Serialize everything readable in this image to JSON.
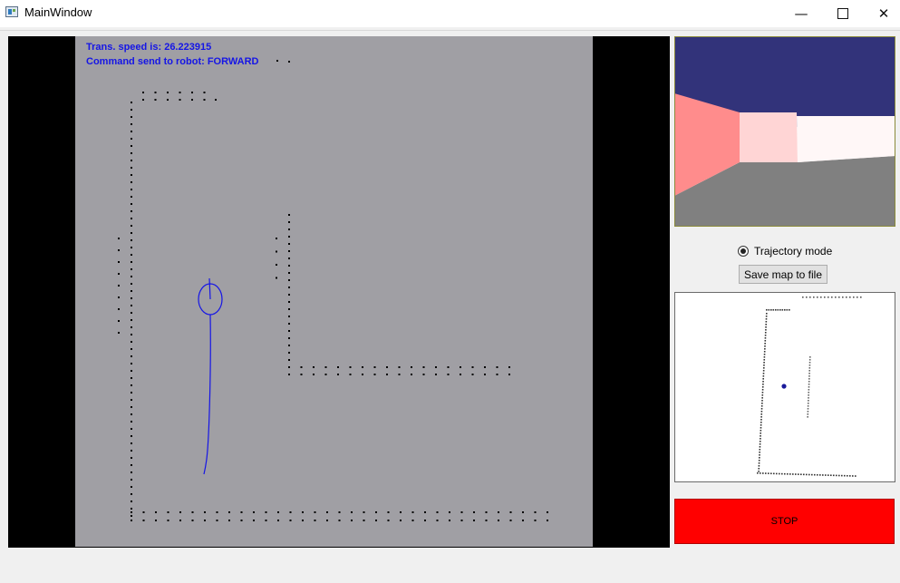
{
  "window": {
    "title": "MainWindow",
    "controls": [
      "minimize",
      "maximize",
      "close"
    ]
  },
  "map": {
    "speed_text": "Trans. speed is: 26.223915",
    "command_text": "Command send to robot: FORWARD",
    "background_color": "#a09fa4",
    "point_color": "#000000",
    "robot_color": "#1515e6"
  },
  "camera": {
    "colors": {
      "sky": "#32337a",
      "floor": "#808080",
      "wall_left": "#ff8c8c",
      "wall_front": "#ffd5d5",
      "wall_right": "#fff7f7"
    }
  },
  "controls": {
    "trajectory_label": "Trajectory mode",
    "trajectory_checked": true,
    "save_label": "Save map to file",
    "stop_label": "STOP",
    "stop_color": "#ff0000"
  }
}
